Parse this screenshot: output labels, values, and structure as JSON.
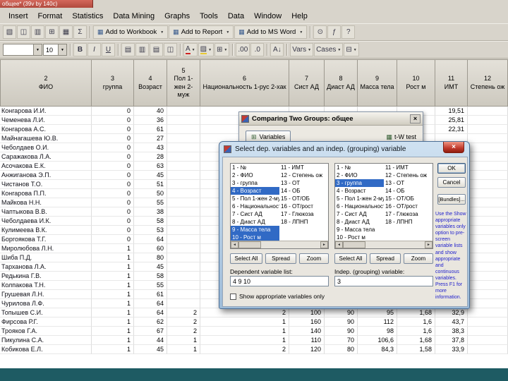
{
  "window": {
    "title": "общее* (39v by 140c)"
  },
  "icons": {
    "close": "×",
    "dropdown": "▼",
    "scroll_left": "◄",
    "scroll_right": "►"
  },
  "menu": {
    "items": [
      "Insert",
      "Format",
      "Statistics",
      "Data Mining",
      "Graphs",
      "Tools",
      "Data",
      "Window",
      "Help"
    ]
  },
  "toolbar1": {
    "icons_left": [
      {
        "name": "analysis-icon",
        "glyph": "▧"
      },
      {
        "name": "copy-icon",
        "glyph": "◫"
      },
      {
        "name": "paste-icon",
        "glyph": "▥"
      },
      {
        "name": "grid-icon",
        "glyph": "⊞"
      },
      {
        "name": "print-icon",
        "glyph": "▦"
      },
      {
        "name": "sum-icon",
        "glyph": "Σ"
      }
    ],
    "buttons": [
      {
        "name": "add-to-workbook-button",
        "label": "Add to Workbook"
      },
      {
        "name": "add-to-report-button",
        "label": "Add to Report"
      },
      {
        "name": "add-to-ms-word-button",
        "label": "Add to MS Word"
      }
    ],
    "icons_right": [
      {
        "name": "zoom-icon",
        "glyph": "⊙"
      },
      {
        "name": "function-icon",
        "glyph": "ƒ"
      },
      {
        "name": "whats-this-icon",
        "glyph": "?"
      }
    ]
  },
  "toolbar2": {
    "items": [
      {
        "type": "select",
        "name": "format-select",
        "value": "",
        "w": 56
      },
      {
        "type": "select",
        "name": "font-size-select",
        "value": "10",
        "w": 34
      },
      {
        "type": "sep"
      },
      {
        "type": "btn",
        "name": "bold-button",
        "glyph": "B",
        "cls": "g-b"
      },
      {
        "type": "btn",
        "name": "italic-button",
        "glyph": "I",
        "cls": "g-i"
      },
      {
        "type": "btn",
        "name": "underline-button",
        "glyph": "U",
        "cls": "g-u"
      },
      {
        "type": "sep"
      },
      {
        "type": "btn",
        "name": "align-left-button",
        "glyph": "▤"
      },
      {
        "type": "btn",
        "name": "align-center-button",
        "glyph": "▥"
      },
      {
        "type": "btn",
        "name": "align-right-button",
        "glyph": "▤"
      },
      {
        "type": "btn",
        "name": "merge-cells-button",
        "glyph": "◫"
      },
      {
        "type": "sep"
      },
      {
        "type": "btnd",
        "name": "font-color-button",
        "glyph": "A",
        "accent": "#cc2222"
      },
      {
        "type": "btnd",
        "name": "fill-color-button",
        "glyph": "▨",
        "accent": "#e8c832"
      },
      {
        "type": "btnd",
        "name": "borders-button",
        "glyph": "⊞",
        "accent": ""
      },
      {
        "type": "sep"
      },
      {
        "type": "btn",
        "name": "increase-decimals-button",
        "glyph": ".00"
      },
      {
        "type": "btn",
        "name": "decrease-decimals-button",
        "glyph": ".0"
      },
      {
        "type": "sep"
      },
      {
        "type": "btn",
        "name": "sort-button",
        "glyph": "A↓"
      },
      {
        "type": "sep"
      },
      {
        "type": "btnd",
        "name": "vars-button",
        "glyph": "Vars"
      },
      {
        "type": "btnd",
        "name": "cases-button",
        "glyph": "Cases"
      },
      {
        "type": "btnd",
        "name": "blocks-button",
        "glyph": "⊟"
      }
    ]
  },
  "sheet": {
    "columns": [
      {
        "num": "2",
        "label": "ФИО"
      },
      {
        "num": "3",
        "label": "группа"
      },
      {
        "num": "4",
        "label": "Возраст"
      },
      {
        "num": "5",
        "label": "Пол 1-жен 2-муж"
      },
      {
        "num": "6",
        "label": "Национальность 1-рус 2-хак"
      },
      {
        "num": "7",
        "label": "Сист АД"
      },
      {
        "num": "8",
        "label": "Диаст АД"
      },
      {
        "num": "9",
        "label": "Масса тела"
      },
      {
        "num": "10",
        "label": "Рост м"
      },
      {
        "num": "11",
        "label": "ИМТ"
      },
      {
        "num": "12",
        "label": "Степень ож"
      }
    ],
    "rows": [
      [
        "Конгарова И.И.",
        "0",
        "40",
        "",
        "",
        "",
        "",
        "",
        "",
        "19,51",
        ""
      ],
      [
        "Чеменева Л.И.",
        "0",
        "36",
        "",
        "",
        "",
        "",
        "",
        "",
        "25,81",
        ""
      ],
      [
        "Конгарова А.С.",
        "0",
        "61",
        "",
        "",
        "",
        "",
        "",
        "",
        "22,31",
        ""
      ],
      [
        "Майнагашева Ю.В.",
        "0",
        "27",
        "",
        "",
        "",
        "",
        "",
        "",
        "",
        ""
      ],
      [
        "Чеболдаев О.И.",
        "0",
        "43",
        "",
        "",
        "",
        "",
        "",
        "",
        "",
        ""
      ],
      [
        "Саражакова Л.А.",
        "0",
        "28",
        "",
        "",
        "",
        "",
        "",
        "",
        "",
        ""
      ],
      [
        "Асочакова Е.К.",
        "0",
        "63",
        "",
        "",
        "",
        "",
        "",
        "",
        "",
        ""
      ],
      [
        "Анжиганова Э.П.",
        "0",
        "45",
        "",
        "",
        "",
        "",
        "",
        "",
        "",
        ""
      ],
      [
        "Чистанов Т.О.",
        "0",
        "51",
        "",
        "",
        "",
        "",
        "",
        "",
        "",
        ""
      ],
      [
        "Конгарова П.П.",
        "0",
        "50",
        "",
        "",
        "",
        "",
        "",
        "",
        "",
        ""
      ],
      [
        "Майкова Н.Н.",
        "0",
        "55",
        "",
        "",
        "",
        "",
        "",
        "",
        "",
        ""
      ],
      [
        "Чаптыкова В.В.",
        "0",
        "38",
        "",
        "",
        "",
        "",
        "",
        "",
        "",
        ""
      ],
      [
        "Чеболдаева И.К.",
        "0",
        "58",
        "",
        "",
        "",
        "",
        "",
        "",
        "",
        ""
      ],
      [
        "Кулимеева В.К.",
        "0",
        "53",
        "",
        "",
        "",
        "",
        "",
        "",
        "",
        ""
      ],
      [
        "Боргоякова Т.Г.",
        "0",
        "64",
        "",
        "",
        "",
        "",
        "",
        "",
        "",
        ""
      ],
      [
        "Миролюбова Л.Н.",
        "1",
        "60",
        "",
        "",
        "",
        "",
        "",
        "",
        "",
        ""
      ],
      [
        "Шиба П.Д.",
        "1",
        "80",
        "",
        "",
        "",
        "",
        "",
        "",
        "",
        ""
      ],
      [
        "Тарханова Л.А.",
        "1",
        "45",
        "",
        "",
        "",
        "",
        "",
        "",
        "",
        ""
      ],
      [
        "Редькина Г.В.",
        "1",
        "58",
        "",
        "",
        "",
        "",
        "",
        "",
        "",
        ""
      ],
      [
        "Колпакова Т.Н.",
        "1",
        "55",
        "",
        "",
        "",
        "",
        "",
        "",
        "",
        ""
      ],
      [
        "Грушевая Л.Н.",
        "1",
        "61",
        "",
        "",
        "",
        "",
        "",
        "",
        "",
        ""
      ],
      [
        "Чурилова Л.Ф.",
        "1",
        "64",
        "",
        "",
        "",
        "",
        "",
        "",
        "",
        ""
      ],
      [
        "Топышев С.И.",
        "1",
        "64",
        "2",
        "2",
        "100",
        "90",
        "95",
        "1,68",
        "32,9",
        ""
      ],
      [
        "Фирсова Р.Г.",
        "1",
        "62",
        "2",
        "1",
        "160",
        "90",
        "112",
        "1,6",
        "43,7",
        ""
      ],
      [
        "Трояков Г.А.",
        "1",
        "67",
        "2",
        "1",
        "140",
        "90",
        "98",
        "1,6",
        "38,3",
        ""
      ],
      [
        "Пикулина С.А.",
        "1",
        "44",
        "1",
        "1",
        "110",
        "70",
        "106,6",
        "1,68",
        "37,8",
        ""
      ],
      [
        "Кобикова Е.Л.",
        "1",
        "45",
        "1",
        "2",
        "120",
        "80",
        "84,3",
        "1,58",
        "33,9",
        ""
      ]
    ]
  },
  "dialog1": {
    "title": "Comparing Two Groups: общее",
    "variables_button": "Variables",
    "test_label": "t-W test"
  },
  "dialog2": {
    "title": "Select dep. variables and an indep. (grouping) variable",
    "variables_col1": [
      "1 - №",
      "2 - ФИО",
      "3 - группа",
      "4 - Возраст",
      "5 - Пол 1-жен 2-муж",
      "6 - Национальность 1-рус 2-хак",
      "7 - Сист АД",
      "8 - Диаст АД",
      "9 - Масса тела",
      "10 - Рост м"
    ],
    "variables_col2": [
      "11 - ИМТ",
      "12 - Степень ож",
      "13 - ОТ",
      "14 - ОБ",
      "15 - ОТ/ОБ",
      "16 - ОТ/рост",
      "17 - Глюкоза",
      "18 - ЛПНП"
    ],
    "left_selected": [
      4,
      9,
      10
    ],
    "right_selected": [
      3
    ],
    "buttons": {
      "select_all": "Select All",
      "spread": "Spread",
      "zoom": "Zoom",
      "ok": "OK",
      "cancel": "Cancel",
      "bundles": "[Bundles]..."
    },
    "dep_label": "Dependent variable list:",
    "dep_value": "4 9 10",
    "group_label": "Indep. (grouping) variable:",
    "group_value": "3",
    "checkbox_label": "Show appropriate variables only",
    "help_text": "Use the Show appropriate variables only option to pre-screen variable lists and show appropriate and continuous variables. Press F1 for more information."
  },
  "colors": {
    "selection_blue": "#316ac5",
    "sheet_title_red": "#c4524a",
    "taskbar_teal": "#1e5b63",
    "help_text_blue": "#2222cc"
  }
}
